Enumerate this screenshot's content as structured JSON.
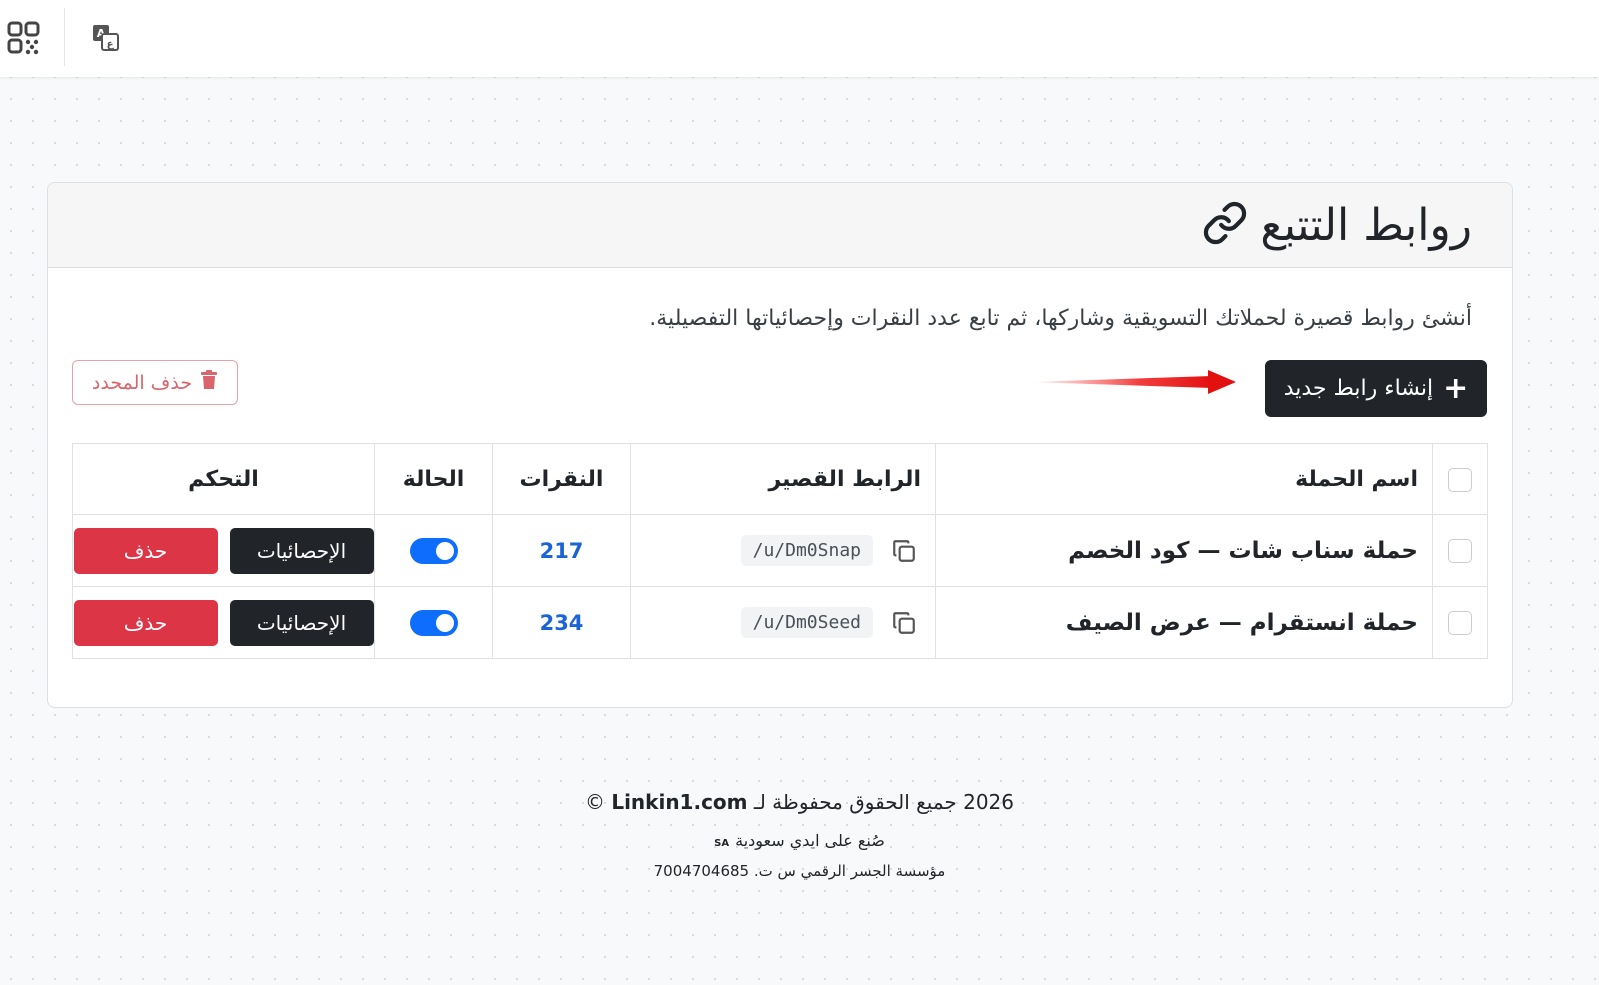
{
  "topbar": {
    "apps_icon": "apps-grid-icon",
    "translate_icon": "translate-icon"
  },
  "card": {
    "title": "روابط التتبع",
    "title_icon": "link-icon",
    "description": "أنشئ روابط قصيرة لحملاتك التسويقية وشاركها، ثم تابع عدد النقرات وإحصائياتها التفصيلية.",
    "create_button": "إنشاء رابط جديد",
    "delete_selected_button": "حذف المحدد"
  },
  "table": {
    "headers": {
      "name": "اسم الحملة",
      "short_link": "الرابط القصير",
      "clicks": "النقرات",
      "status": "الحالة",
      "control": "التحكم"
    },
    "rows": [
      {
        "name": "حملة سناب شات — كود الخصم",
        "link": "/u/Dm0Snap",
        "clicks": "217",
        "active": true,
        "stats": "الإحصائيات",
        "delete": "حذف"
      },
      {
        "name": "حملة انستقرام — عرض الصيف",
        "link": "/u/Dm0Seed",
        "clicks": "234",
        "active": true,
        "stats": "الإحصائيات",
        "delete": "حذف"
      }
    ]
  },
  "footer": {
    "year_text": "2026 جميع الحقوق محفوظة لـ",
    "site": "Linkin1.com",
    "copyright": "©",
    "made_in": "صُنع على ايدي سعودية",
    "made_in_badge": "SA",
    "company": "مؤسسة الجسر الرقمي س ت. 7004704685"
  },
  "colors": {
    "primary_dark": "#212529",
    "danger": "#dc3545",
    "link_blue": "#1a64d6",
    "toggle_on": "#0d6efd"
  }
}
